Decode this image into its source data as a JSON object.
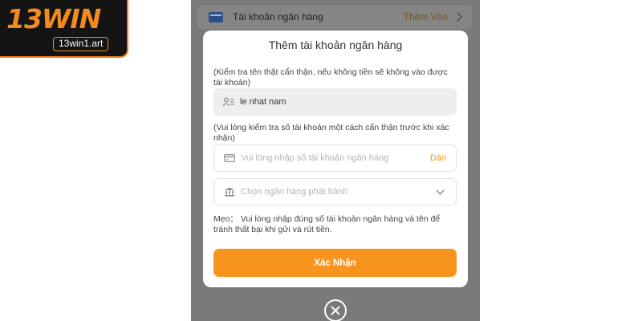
{
  "logo": {
    "brand": "13WIN",
    "url": "13win1.art"
  },
  "background_row": {
    "label": "Tài khoản ngân hàng",
    "action": "Thêm Vào"
  },
  "modal": {
    "title": "Thêm tài khoản ngân hàng",
    "name_hint": "(Kiểm tra tên thật cẩn thận, nếu không tiền sẽ không vào được tài khoản)",
    "name_value": "le nhat nam",
    "account_hint": "(Vui lòng kiểm tra số tài khoản một cách cẩn thận trước khi xác nhận)",
    "account_placeholder": "Vui lòng nhập số tài khoản ngân hàng",
    "paste_label": "Dán",
    "bank_placeholder": "Chọn ngân hàng phát hành",
    "tip": "Mẹo： Vui lòng nhập đúng số tài khoản ngân hàng và tên để tránh thất bại khi gửi và rút tiền.",
    "confirm_label": "Xác Nhận"
  },
  "icons": [
    "bank-card-icon",
    "user-id-icon",
    "credit-card-icon",
    "bank-building-icon",
    "chevron-right-icon",
    "chevron-down-icon",
    "close-icon"
  ],
  "colors": {
    "accent": "#f7941d",
    "overlay": "#7a7a7a",
    "logo_bg": "#141414"
  }
}
